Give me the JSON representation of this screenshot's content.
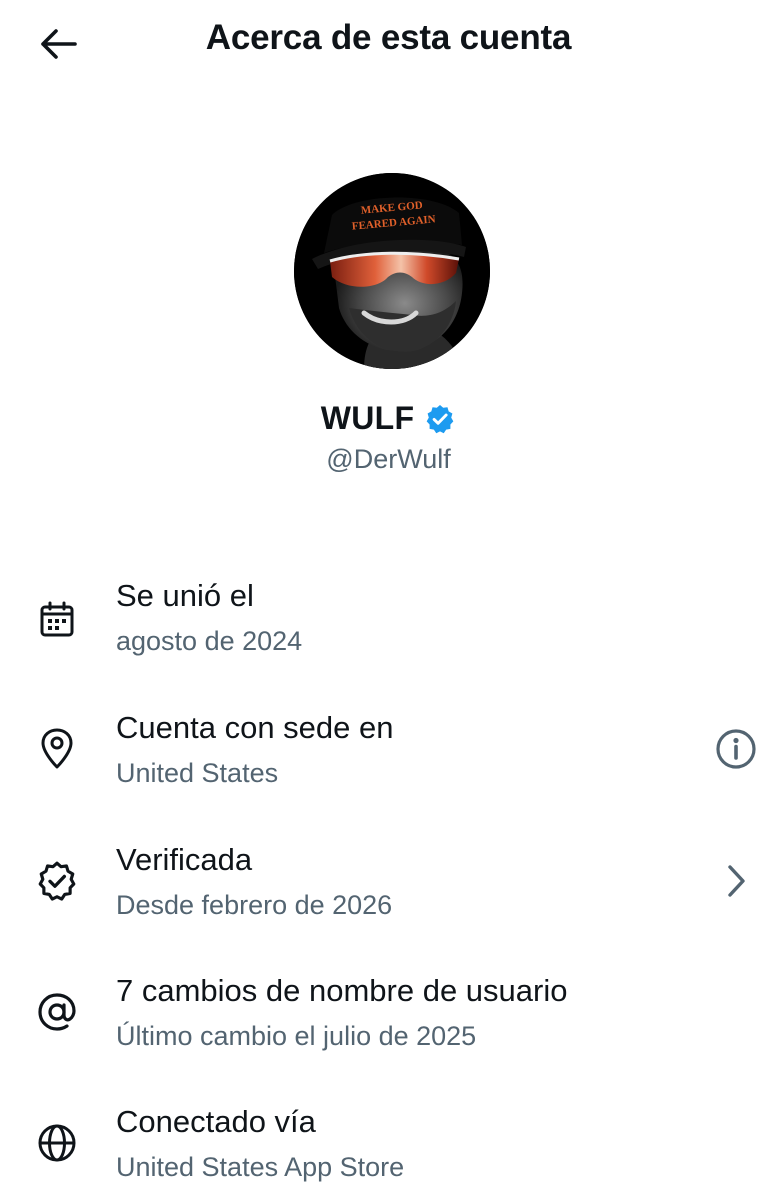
{
  "header": {
    "title": "Acerca de esta cuenta",
    "back_icon": "arrow-left-icon"
  },
  "profile": {
    "display_name": "WULF",
    "handle": "@DerWulf",
    "verified": true,
    "verified_badge_color": "#1d9bf0",
    "avatar_hat_text": [
      "MAKE GOD",
      "FEARED AGAIN"
    ]
  },
  "info": {
    "joined": {
      "icon": "calendar-icon",
      "title": "Se unió el",
      "subtitle": "agosto de 2024"
    },
    "location": {
      "icon": "location-pin-icon",
      "title": "Cuenta con sede en",
      "subtitle": "United States",
      "trailing_icon": "info-icon"
    },
    "verified": {
      "icon": "verified-badge-icon",
      "title": "Verificada",
      "subtitle": "Desde febrero de 2026",
      "trailing_icon": "chevron-right-icon"
    },
    "username_changes": {
      "icon": "at-sign-icon",
      "title": "7 cambios de nombre de usuario",
      "subtitle": "Último cambio el julio de 2025"
    },
    "connected_via": {
      "icon": "globe-icon",
      "title": "Conectado vía",
      "subtitle": "United States App Store"
    }
  },
  "colors": {
    "text_primary": "#0f1419",
    "text_secondary": "#536471",
    "background": "#ffffff"
  }
}
